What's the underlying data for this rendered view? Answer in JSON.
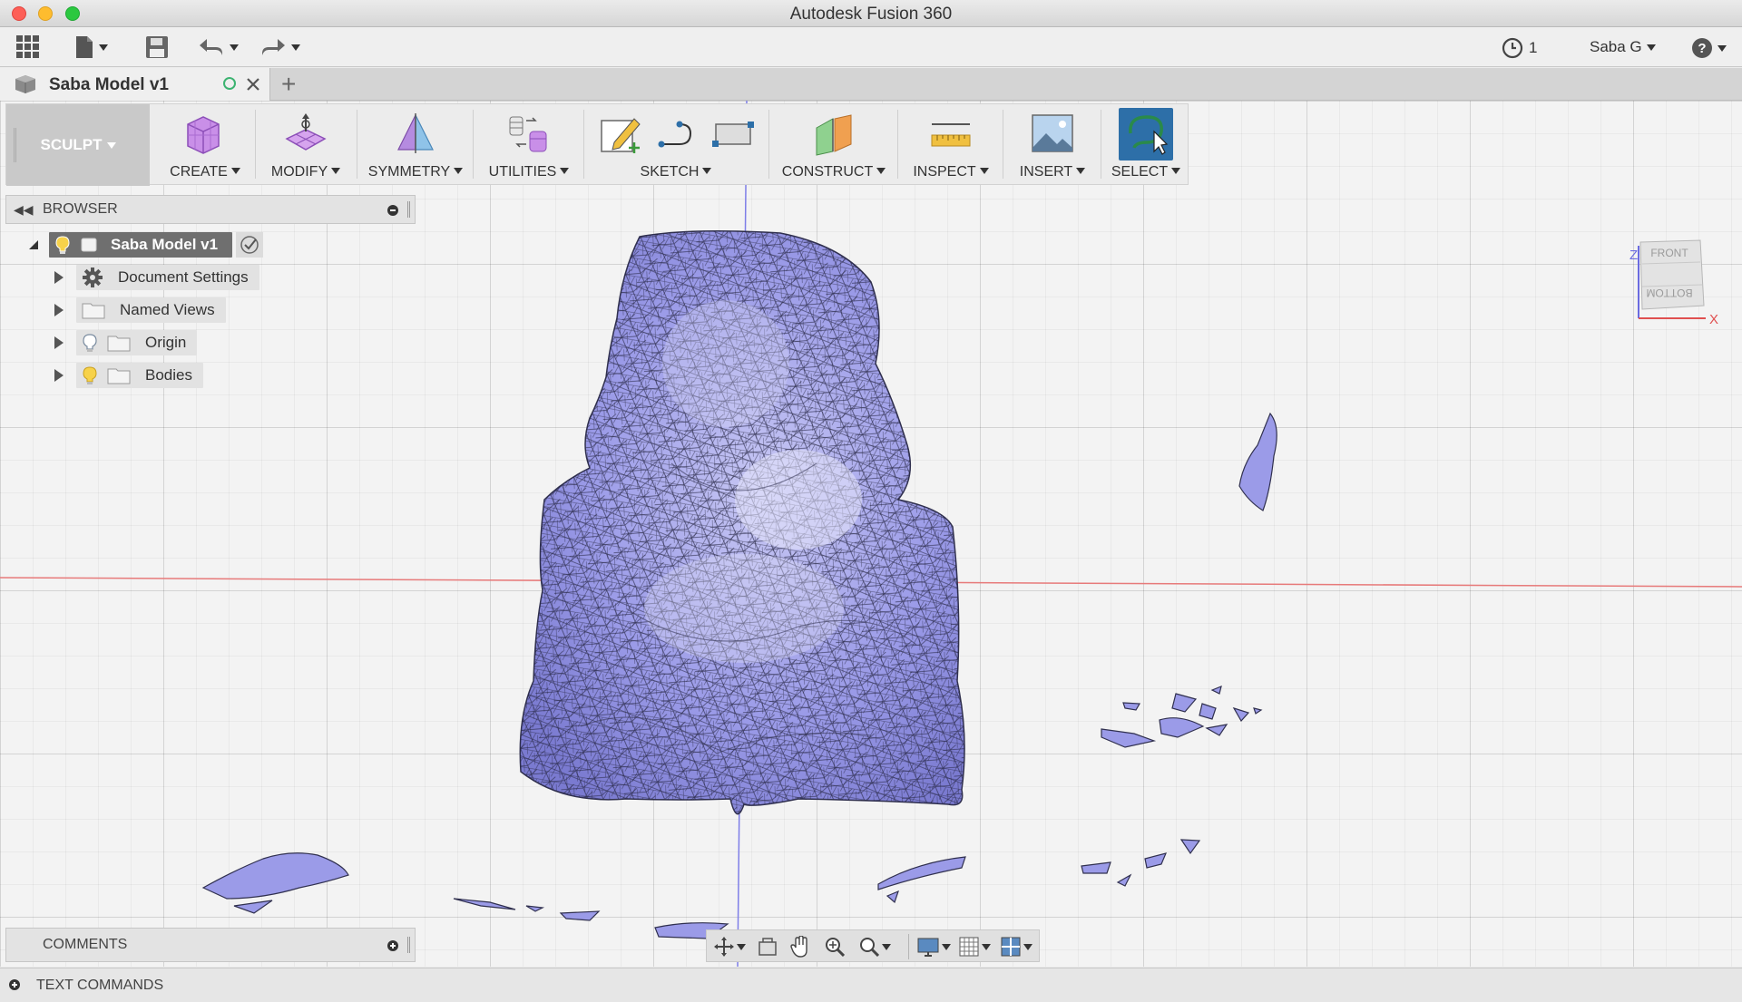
{
  "window": {
    "title": "Autodesk Fusion 360"
  },
  "quick_access": {
    "data_panel_icon": "grid-icon",
    "file_icon": "file-icon",
    "save_icon": "save-icon",
    "undo_icon": "undo-icon",
    "redo_icon": "redo-icon",
    "job_status_count": "1",
    "user_name": "Saba G",
    "help_icon": "help-icon"
  },
  "tab": {
    "label": "Saba Model v1"
  },
  "ribbon": {
    "workspace": "SCULPT",
    "groups": [
      {
        "label": "CREATE",
        "icon": "box-create-icon"
      },
      {
        "label": "MODIFY",
        "icon": "modify-surface-icon"
      },
      {
        "label": "SYMMETRY",
        "icon": "symmetry-icon"
      },
      {
        "label": "UTILITIES",
        "icon": "utilities-icon"
      },
      {
        "label": "SKETCH",
        "icon": "sketch-icon"
      },
      {
        "label": "CONSTRUCT",
        "icon": "construct-plane-icon"
      },
      {
        "label": "INSPECT",
        "icon": "measure-icon"
      },
      {
        "label": "INSERT",
        "icon": "insert-image-icon"
      },
      {
        "label": "SELECT",
        "icon": "select-lasso-icon"
      }
    ]
  },
  "browser": {
    "title": "BROWSER",
    "root": {
      "label": "Saba Model v1"
    },
    "items": [
      {
        "label": "Document Settings",
        "icon": "gear-icon"
      },
      {
        "label": "Named Views",
        "icon": "folder-icon"
      },
      {
        "label": "Origin",
        "icon": "folder-icon"
      },
      {
        "label": "Bodies",
        "icon": "folder-icon"
      }
    ]
  },
  "viewcube": {
    "front": "FRONT",
    "bottom": "BOTTOM",
    "axis_z": "Z",
    "axis_x": "X"
  },
  "comments": {
    "label": "COMMENTS"
  },
  "text_commands": {
    "label": "TEXT COMMANDS"
  },
  "colors": {
    "mesh_fill": "#9b9be8",
    "x_axis": "#e77a7a",
    "y_axis": "#7e7ee8",
    "select_accent": "#2d6fa8"
  }
}
